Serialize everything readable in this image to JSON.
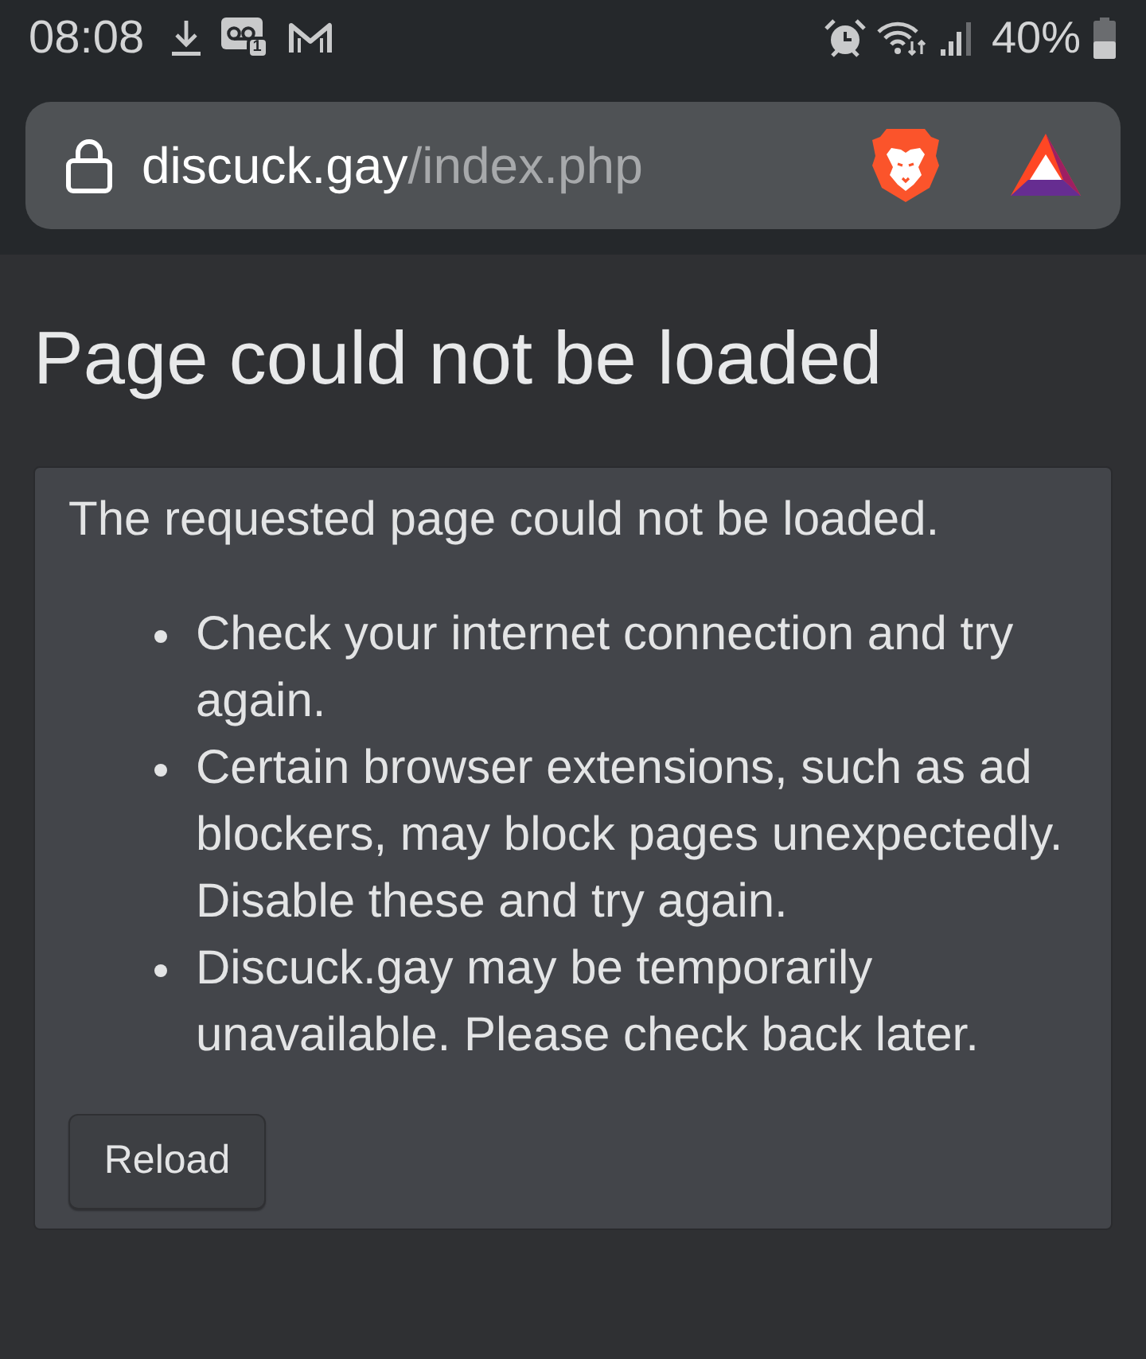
{
  "status_bar": {
    "time": "08:08",
    "voicemail_count": "1",
    "battery": "40%"
  },
  "address_bar": {
    "host": "discuck.gay",
    "path": "/index.php"
  },
  "page": {
    "title": "Page could not be loaded",
    "message": "The requested page could not be loaded.",
    "tips": [
      "Check your internet connection and try again.",
      "Certain browser extensions, such as ad blockers, may block pages unexpectedly. Disable these and try again.",
      "Discuck.gay may be temporarily unavailable. Please check back later."
    ],
    "button": "Reload"
  }
}
